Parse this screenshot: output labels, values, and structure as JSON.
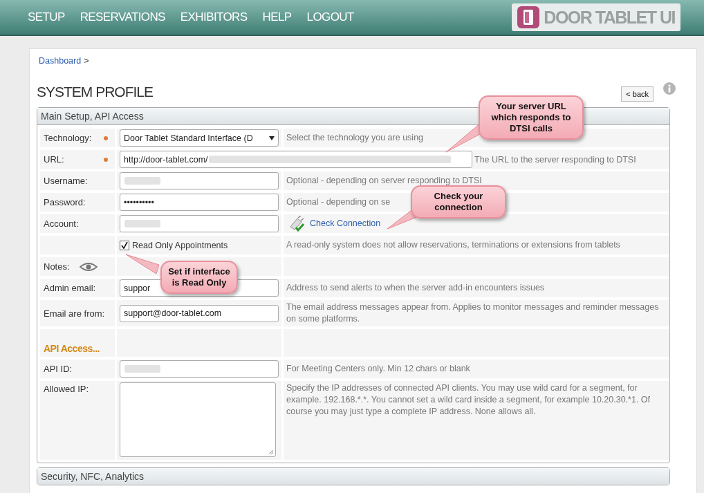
{
  "nav": {
    "items": [
      "SETUP",
      "RESERVATIONS",
      "EXHIBITORS",
      "HELP",
      "LOGOUT"
    ],
    "logo": "DOOR TABLET UI"
  },
  "breadcrumb": {
    "link": "Dashboard",
    "separator": ">"
  },
  "page": {
    "title": "SYSTEM PROFILE",
    "back_button": "< back"
  },
  "sections": [
    {
      "title": "Main Setup, API Access",
      "expanded": true,
      "rows": [
        {
          "kind": "select",
          "label": "Technology:",
          "required": true,
          "value": "Door Tablet Standard Interface (D",
          "hint": "Select the technology you are using"
        },
        {
          "kind": "url",
          "label": "URL:",
          "required": true,
          "value": "http://door-tablet.com/",
          "blurred": true,
          "hint": "The URL to the server responding to DTSI"
        },
        {
          "kind": "text",
          "label": "Username:",
          "required": false,
          "blurred": true,
          "hint": "Optional - depending on server responding to DTSI"
        },
        {
          "kind": "password",
          "label": "Password:",
          "required": false,
          "value": "••••••••••",
          "hint": "Optional - depending on se"
        },
        {
          "kind": "link",
          "label": "Account:",
          "required": false,
          "blurred": true,
          "link": "Check Connection"
        },
        {
          "kind": "check",
          "checkbox": "Read Only Appointments",
          "checked": true,
          "hint": "A read-only system does not allow reservations, terminations or extensions from tablets"
        },
        {
          "kind": "notes",
          "label": "Notes:"
        },
        {
          "kind": "text",
          "label": "Admin email:",
          "required": false,
          "value": "suppor",
          "hint": "Address to send alerts to when the server add-in encounters issues"
        },
        {
          "kind": "text",
          "label": "Email are from:",
          "required": false,
          "value": "support@door-tablet.com",
          "hint": "The email address messages appear from. Applies to monitor messages and reminder messages on some platforms."
        },
        {
          "kind": "heading",
          "label": "API Access..."
        },
        {
          "kind": "text",
          "label": "API ID:",
          "required": false,
          "blurred": true,
          "hint": "For Meeting Centers only. Min 12 chars or blank"
        },
        {
          "kind": "textarea",
          "label": "Allowed IP:",
          "hint": "Specify the IP addresses of connected API clients. You may use wild card for a segment, for example. 192.168.*.*. You cannot set a wild card inside a segment, for example 10.20.30.*1. Of course you may just type a complete IP address. None allows all."
        }
      ]
    },
    {
      "title": "Security, NFC, Analytics",
      "expanded": false
    }
  ],
  "callouts": [
    {
      "kind": "url",
      "text": "Your server URL which responds to DTSI calls"
    },
    {
      "kind": "connection",
      "text": "Check your connection"
    },
    {
      "kind": "readonly",
      "text": "Set if interface is Read Only"
    }
  ]
}
